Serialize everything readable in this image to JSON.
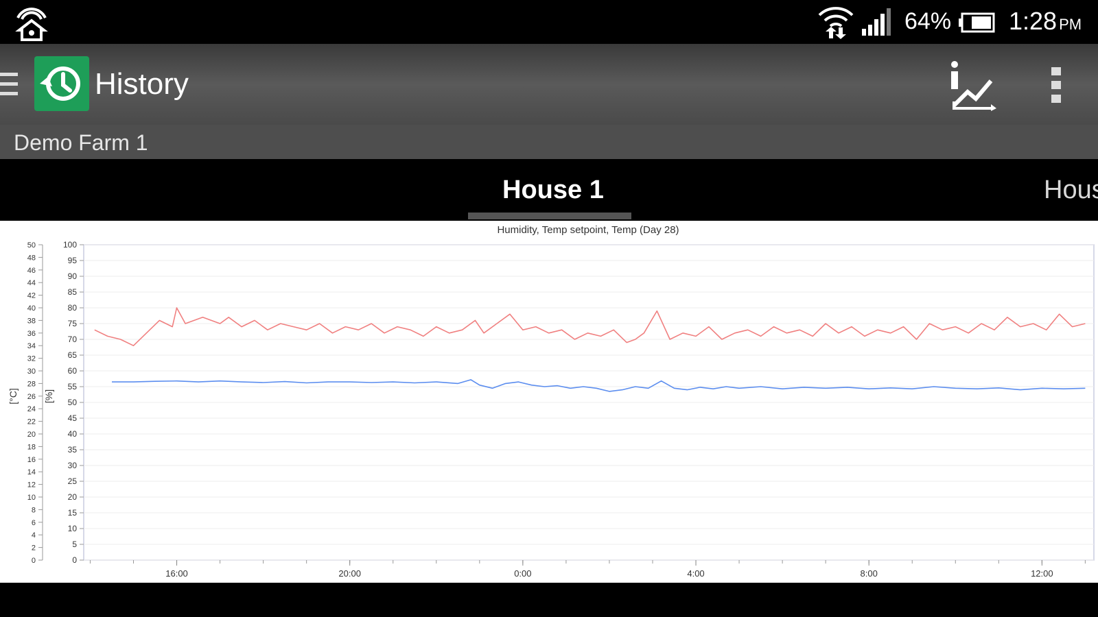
{
  "status_bar": {
    "battery_percent": "64%",
    "time": "1:28",
    "time_suffix": "PM",
    "icons": [
      "home-network-icon",
      "wifi-icon",
      "cell-signal-icon",
      "battery-icon"
    ]
  },
  "app_bar": {
    "title": "History",
    "logo_icon": "history-clock-icon",
    "actions": [
      "chart-info-icon",
      "overflow-menu-icon"
    ],
    "accent_color": "#1e9e58"
  },
  "sub_bar": {
    "farm": "Demo Farm 1"
  },
  "tabs": [
    {
      "label": "House 1",
      "selected": true
    },
    {
      "label": "Hous",
      "selected": false
    }
  ],
  "chart_data": {
    "type": "line",
    "title": "Humidity, Temp setpoint, Temp (Day 28)",
    "left_axis_label": "[°C]",
    "right_axis_label": "[%]",
    "y_left_ticks": [
      "0",
      "2",
      "4",
      "6",
      "8",
      "10",
      "12",
      "14",
      "16",
      "18",
      "20",
      "22",
      "24",
      "26",
      "28",
      "30",
      "32",
      "34",
      "36",
      "38",
      "40",
      "42",
      "44",
      "46",
      "48",
      "50"
    ],
    "y_right_ticks": [
      "0",
      "5",
      "10",
      "15",
      "20",
      "25",
      "30",
      "35",
      "40",
      "45",
      "50",
      "55",
      "60",
      "65",
      "70",
      "75",
      "80",
      "85",
      "90",
      "95",
      "100"
    ],
    "ylim_percent": [
      0,
      100
    ],
    "ylim_celsius": [
      0,
      50
    ],
    "x_ticks": [
      "16:00",
      "20:00",
      "0:00",
      "4:00",
      "8:00",
      "12:00"
    ],
    "x_tick_hours": [
      16,
      20,
      24,
      28,
      32,
      36
    ],
    "xlim_hours": [
      13.85,
      37.2
    ],
    "grid": true,
    "series": [
      {
        "color": "#f08080",
        "x": [
          14.1,
          14.4,
          14.7,
          15.0,
          15.3,
          15.6,
          15.9,
          16.0,
          16.2,
          16.6,
          17.0,
          17.2,
          17.5,
          17.8,
          18.1,
          18.4,
          18.7,
          19.0,
          19.3,
          19.6,
          19.9,
          20.2,
          20.5,
          20.8,
          21.1,
          21.4,
          21.7,
          22.0,
          22.3,
          22.6,
          22.9,
          23.1,
          23.4,
          23.7,
          24.0,
          24.3,
          24.6,
          24.9,
          25.2,
          25.5,
          25.8,
          26.1,
          26.4,
          26.6,
          26.8,
          27.1,
          27.4,
          27.7,
          28.0,
          28.3,
          28.6,
          28.9,
          29.2,
          29.5,
          29.8,
          30.1,
          30.4,
          30.7,
          31.0,
          31.3,
          31.6,
          31.9,
          32.2,
          32.5,
          32.8,
          33.1,
          33.4,
          33.7,
          34.0,
          34.3,
          34.6,
          34.9,
          35.2,
          35.5,
          35.8,
          36.1,
          36.4,
          36.7,
          37.0
        ],
        "y": [
          73,
          71,
          70,
          68,
          72,
          76,
          74,
          80,
          75,
          77,
          75,
          77,
          74,
          76,
          73,
          75,
          74,
          73,
          75,
          72,
          74,
          73,
          75,
          72,
          74,
          73,
          71,
          74,
          72,
          73,
          76,
          72,
          75,
          78,
          73,
          74,
          72,
          73,
          70,
          72,
          71,
          73,
          69,
          70,
          72,
          79,
          70,
          72,
          71,
          74,
          70,
          72,
          73,
          71,
          74,
          72,
          73,
          71,
          75,
          72,
          74,
          71,
          73,
          72,
          74,
          70,
          75,
          73,
          74,
          72,
          75,
          73,
          77,
          74,
          75,
          73,
          78,
          74,
          75
        ]
      },
      {
        "color": "#5b8def",
        "x": [
          14.5,
          15.0,
          15.5,
          16.0,
          16.5,
          17.0,
          17.5,
          18.0,
          18.5,
          19.0,
          19.5,
          20.0,
          20.5,
          21.0,
          21.5,
          22.0,
          22.5,
          22.8,
          23.0,
          23.3,
          23.6,
          23.9,
          24.2,
          24.5,
          24.8,
          25.1,
          25.4,
          25.7,
          26.0,
          26.3,
          26.6,
          26.9,
          27.2,
          27.5,
          27.8,
          28.1,
          28.4,
          28.7,
          29.0,
          29.5,
          30.0,
          30.5,
          31.0,
          31.5,
          32.0,
          32.5,
          33.0,
          33.5,
          34.0,
          34.5,
          35.0,
          35.5,
          36.0,
          36.5,
          37.0
        ],
        "y": [
          56.5,
          56.5,
          56.7,
          56.8,
          56.5,
          56.8,
          56.5,
          56.3,
          56.6,
          56.2,
          56.5,
          56.5,
          56.3,
          56.5,
          56.2,
          56.5,
          56.0,
          57.2,
          55.5,
          54.5,
          56.0,
          56.5,
          55.5,
          55.0,
          55.3,
          54.5,
          55.0,
          54.5,
          53.5,
          54.0,
          55.0,
          54.5,
          56.8,
          54.5,
          54.0,
          54.8,
          54.3,
          55.0,
          54.5,
          55.0,
          54.3,
          54.8,
          54.5,
          54.8,
          54.3,
          54.6,
          54.3,
          55.0,
          54.5,
          54.3,
          54.6,
          54.0,
          54.5,
          54.3,
          54.5
        ]
      }
    ]
  }
}
